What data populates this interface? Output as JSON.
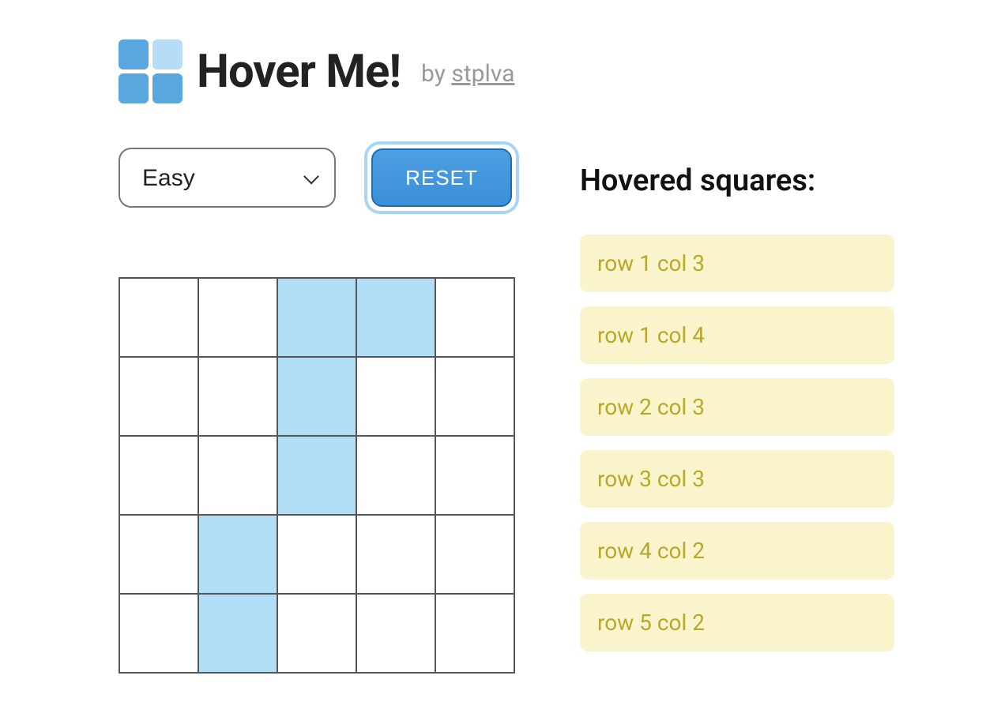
{
  "header": {
    "title": "Hover Me!",
    "byline_prefix": "by ",
    "byline_author": "stplva"
  },
  "controls": {
    "difficulty_selected": "Easy",
    "difficulty_options": [
      "Easy"
    ],
    "reset_label": "RESET"
  },
  "grid": {
    "rows": 5,
    "cols": 5,
    "hovered_cells": [
      {
        "row": 1,
        "col": 3
      },
      {
        "row": 1,
        "col": 4
      },
      {
        "row": 2,
        "col": 3
      },
      {
        "row": 3,
        "col": 3
      },
      {
        "row": 4,
        "col": 2
      },
      {
        "row": 5,
        "col": 2
      }
    ]
  },
  "sidebar": {
    "title": "Hovered squares:",
    "items": [
      "row 1 col 3",
      "row 1 col 4",
      "row 2 col 3",
      "row 3 col 3",
      "row 4 col 2",
      "row 5 col 2"
    ]
  }
}
